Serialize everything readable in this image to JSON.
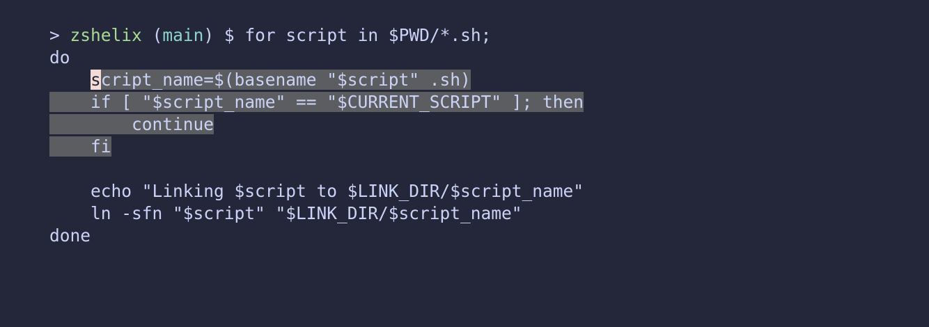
{
  "terminal": {
    "prompt": {
      "arrow": ">",
      "directory": "zshelix",
      "paren_open": "(",
      "branch": "main",
      "paren_close": ")",
      "symbol": "$",
      "command": "for script in $PWD/*.sh;"
    },
    "lines": {
      "l2": "do",
      "l3_indent": "    ",
      "l3_cursor_char": "s",
      "l3_rest": "cript_name=$(basename \"$script\" .sh)",
      "l4": "    if [ \"$script_name\" == \"$CURRENT_SCRIPT\" ]; then",
      "l5": "        continue",
      "l6": "    fi",
      "l7": "",
      "l8": "    echo \"Linking $script to $LINK_DIR/$script_name\"",
      "l9": "    ln -sfn \"$script\" \"$LINK_DIR/$script_name\"",
      "l10": "done"
    },
    "colors": {
      "background": "#24273a",
      "text": "#cad3f5",
      "directory": "#a6da95",
      "branch": "#8bd5ca",
      "selection": "#5b5d61",
      "cursor": "#f4dbd6"
    }
  }
}
